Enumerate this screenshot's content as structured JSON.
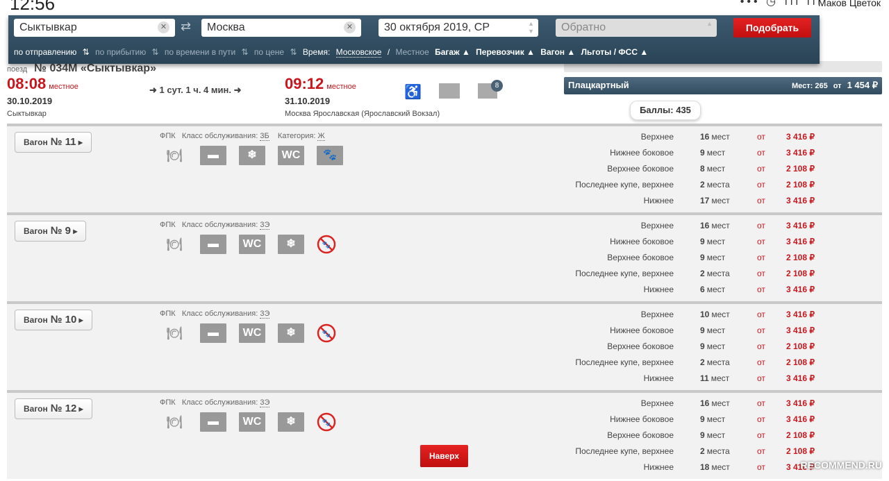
{
  "status_bar": {
    "time": "12:56",
    "icons": "••• ◷ ıll ıll",
    "user": "Маков Цветок"
  },
  "search": {
    "from": "Сыктывкар",
    "to": "Москва",
    "date": "30 октября 2019, СР",
    "return_placeholder": "Обратно",
    "submit": "Подобрать"
  },
  "filters": {
    "sort": [
      "по отправлению",
      "по прибытию",
      "по времени в пути",
      "по цене"
    ],
    "time_label": "Время:",
    "time_moscow": "Московское",
    "sep": "/",
    "time_local": "Местное",
    "dropdowns": [
      "Багаж",
      "Перевозчик",
      "Вагон",
      "Льготы / ФСС"
    ]
  },
  "train": {
    "label": "поезд",
    "number": "№ 034М «Сыктывкар»",
    "dep_time": "08:08",
    "dep_note": "местное",
    "dep_date": "30.10.2019",
    "dep_station": "Сыктывкар",
    "duration": "1 сут. 1 ч. 4 мин.",
    "arr_time": "09:12",
    "arr_note": "местное",
    "arr_date": "31.10.2019",
    "arr_station": "Москва Ярославская (Ярославский Вокзал)",
    "badge": "8"
  },
  "car_class": {
    "name": "Плацкартный",
    "seats": "Мест: 265",
    "from": "от",
    "price": "1 454 ₽"
  },
  "points": "Баллы: 435",
  "wagons": [
    {
      "label": "Вагон",
      "number": "№ 11",
      "carrier": "ФПК",
      "class_label": "Класс обслуживания:",
      "class": "3Б",
      "cat_label": "Категория:",
      "cat": "Ж",
      "icons": [
        "food",
        "baggage",
        "ac",
        "wc",
        "pets"
      ],
      "seats": [
        {
          "type": "Верхнее",
          "n": "16",
          "unit": "мест",
          "price": "3 416 ₽"
        },
        {
          "type": "Нижнее боковое",
          "n": "9",
          "unit": "мест",
          "price": "3 416 ₽"
        },
        {
          "type": "Верхнее боковое",
          "n": "8",
          "unit": "мест",
          "price": "2 108 ₽"
        },
        {
          "type": "Последнее купе, верхнее",
          "n": "2",
          "unit": "места",
          "price": "2 108 ₽"
        },
        {
          "type": "Нижнее",
          "n": "17",
          "unit": "мест",
          "price": "3 416 ₽"
        }
      ]
    },
    {
      "label": "Вагон",
      "number": "№ 9",
      "carrier": "ФПК",
      "class_label": "Класс обслуживания:",
      "class": "3Э",
      "icons": [
        "food",
        "baggage",
        "wc",
        "ac",
        "no-pets"
      ],
      "seats": [
        {
          "type": "Верхнее",
          "n": "16",
          "unit": "мест",
          "price": "3 416 ₽"
        },
        {
          "type": "Нижнее боковое",
          "n": "9",
          "unit": "мест",
          "price": "3 416 ₽"
        },
        {
          "type": "Верхнее боковое",
          "n": "9",
          "unit": "мест",
          "price": "2 108 ₽"
        },
        {
          "type": "Последнее купе, верхнее",
          "n": "2",
          "unit": "места",
          "price": "2 108 ₽"
        },
        {
          "type": "Нижнее",
          "n": "6",
          "unit": "мест",
          "price": "3 416 ₽"
        }
      ]
    },
    {
      "label": "Вагон",
      "number": "№ 10",
      "carrier": "ФПК",
      "class_label": "Класс обслуживания:",
      "class": "3Э",
      "icons": [
        "food",
        "baggage",
        "wc",
        "ac",
        "no-pets"
      ],
      "seats": [
        {
          "type": "Верхнее",
          "n": "10",
          "unit": "мест",
          "price": "3 416 ₽"
        },
        {
          "type": "Нижнее боковое",
          "n": "9",
          "unit": "мест",
          "price": "3 416 ₽"
        },
        {
          "type": "Верхнее боковое",
          "n": "9",
          "unit": "мест",
          "price": "2 108 ₽"
        },
        {
          "type": "Последнее купе, верхнее",
          "n": "2",
          "unit": "места",
          "price": "2 108 ₽"
        },
        {
          "type": "Нижнее",
          "n": "11",
          "unit": "мест",
          "price": "3 416 ₽"
        }
      ]
    },
    {
      "label": "Вагон",
      "number": "№ 12",
      "carrier": "ФПК",
      "class_label": "Класс обслуживания:",
      "class": "3Э",
      "icons": [
        "food",
        "baggage",
        "wc",
        "ac",
        "no-pets"
      ],
      "seats": [
        {
          "type": "Верхнее",
          "n": "16",
          "unit": "мест",
          "price": "3 416 ₽"
        },
        {
          "type": "Нижнее боковое",
          "n": "9",
          "unit": "мест",
          "price": "3 416 ₽"
        },
        {
          "type": "Верхнее боковое",
          "n": "9",
          "unit": "мест",
          "price": "2 108 ₽"
        },
        {
          "type": "Последнее купе, верхнее",
          "n": "2",
          "unit": "места",
          "price": "2 108 ₽"
        },
        {
          "type": "Нижнее",
          "n": "18",
          "unit": "мест",
          "price": "3 416 ₽"
        }
      ]
    }
  ],
  "seat_from": "от",
  "to_top": "Наверх",
  "watermark": "RECOMMEND.RU",
  "colors": {
    "accent": "#c8161d",
    "header": "#2f4a5e"
  }
}
